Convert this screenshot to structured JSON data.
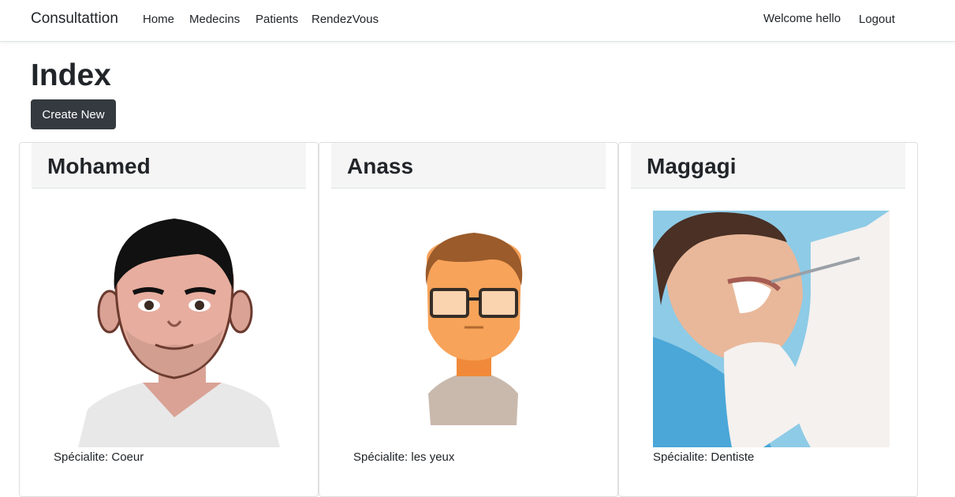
{
  "navbar": {
    "brand": "Consultattion",
    "links": [
      "Home",
      "Medecins",
      "Patients",
      "RendezVous"
    ],
    "welcome": "Welcome hello",
    "logout": "Logout"
  },
  "page": {
    "title": "Index",
    "create_label": "Create New"
  },
  "cards": [
    {
      "name": "Mohamed",
      "specialite": "Spécialite: Coeur",
      "image": "male-doctor-avatar"
    },
    {
      "name": "Anass",
      "specialite": "Spécialite: les yeux",
      "image": "glasses-avatar"
    },
    {
      "name": "Maggagi",
      "specialite": "Spécialite: Dentiste",
      "image": "dental-patient-photo"
    }
  ]
}
